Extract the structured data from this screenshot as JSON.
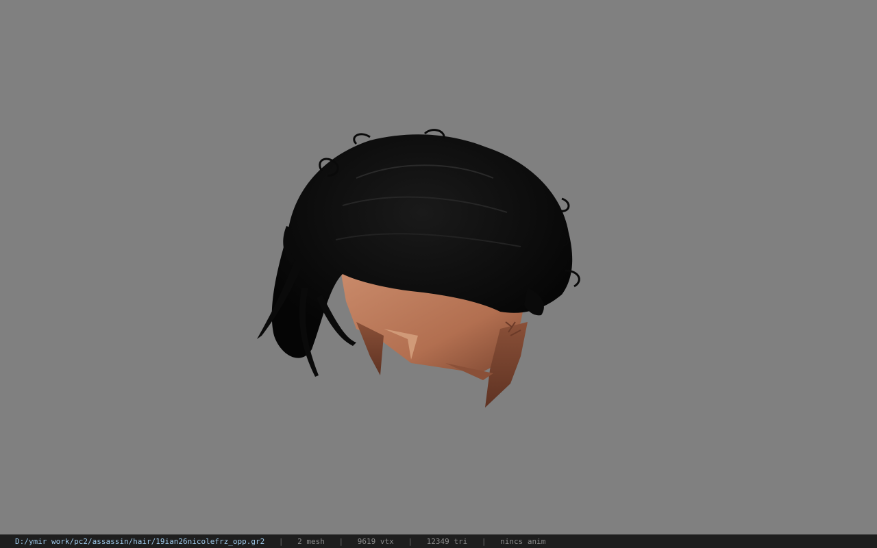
{
  "viewer": {
    "background_color": "#808080",
    "model_icon": "hair-mesh-3d-model"
  },
  "status": {
    "file_path": "D:/ymir work/pc2/assassin/hair/19ian26nicolefrz_opp.gr2",
    "separator": "|",
    "mesh_count": "2 mesh",
    "vertex_count": "9619 vtx",
    "triangle_count": "12349 tri",
    "animation": "nincs anim"
  }
}
